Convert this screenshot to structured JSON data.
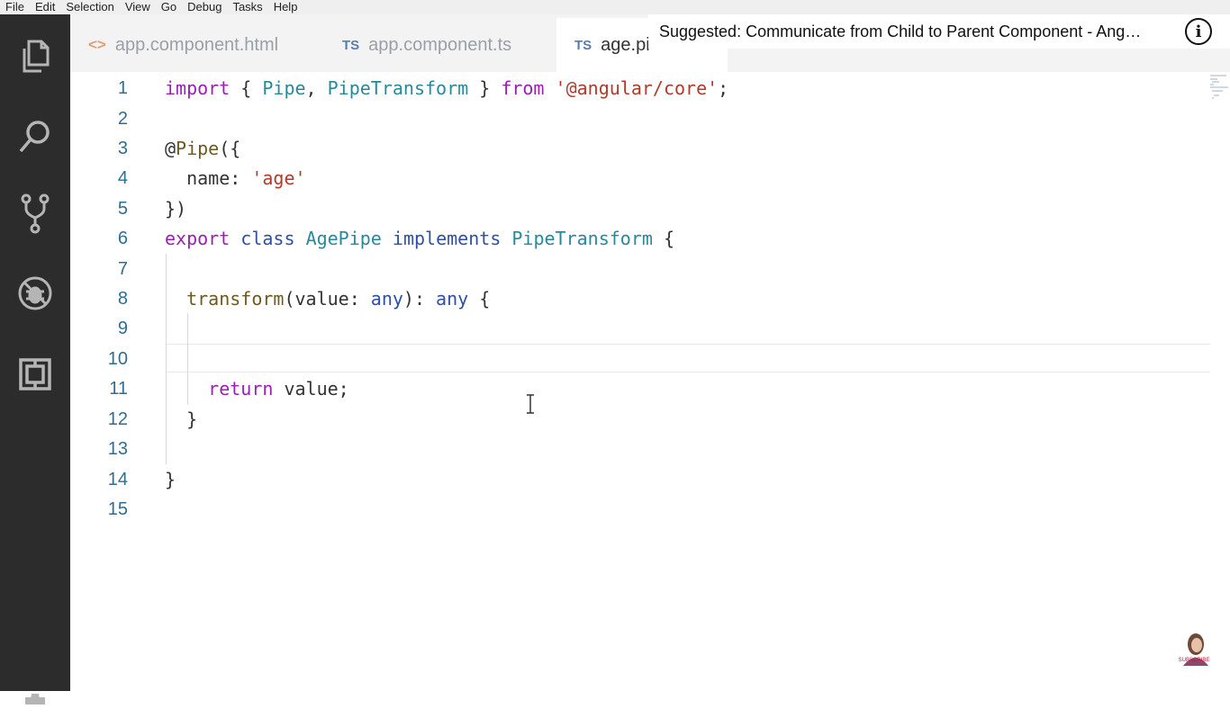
{
  "menu": [
    "File",
    "Edit",
    "Selection",
    "View",
    "Go",
    "Debug",
    "Tasks",
    "Help"
  ],
  "activity_bar": [
    "explorer-icon",
    "search-icon",
    "source-control-icon",
    "debug-icon",
    "extensions-icon",
    "settings-gear-icon"
  ],
  "tabs": [
    {
      "icon": "<>",
      "label": "app.component.html"
    },
    {
      "icon": "TS",
      "label": "app.component.ts"
    },
    {
      "icon": "TS",
      "label": "age.pi",
      "close": "×"
    }
  ],
  "suggestion": {
    "text": "Suggested: Communicate from Child to Parent Component - Ang…",
    "info": "i"
  },
  "editor": {
    "line_numbers": [
      "1",
      "2",
      "3",
      "4",
      "5",
      "6",
      "7",
      "8",
      "9",
      "10",
      "11",
      "12",
      "13",
      "14",
      "15"
    ],
    "l1": {
      "kw_import": "import",
      "p1": " { ",
      "c1": "Pipe",
      "p2": ", ",
      "c2": "PipeTransform",
      "p3": " } ",
      "kw_from": "from",
      "p4": " ",
      "s1": "'@angular/core'",
      "p5": ";"
    },
    "l3": {
      "t1": "@",
      "f1": "Pipe",
      "t2": "({"
    },
    "l4": {
      "t1": "  name: ",
      "s1": "'age'"
    },
    "l5": {
      "t1": "})"
    },
    "l6": {
      "k1": "export",
      "p1": " ",
      "k2": "class",
      "p2": " ",
      "c1": "AgePipe",
      "p3": " ",
      "k3": "implements",
      "p4": " ",
      "c2": "PipeTransform",
      "p5": " {"
    },
    "l8": {
      "t0": "  ",
      "f1": "transform",
      "t1": "(value: ",
      "ty1": "any",
      "t2": "): ",
      "ty2": "any",
      "t3": " {"
    },
    "l11": {
      "t0": "    ",
      "k1": "return",
      "t1": " value;"
    },
    "l12": {
      "t1": "  }"
    },
    "l14": {
      "t1": "}"
    }
  },
  "watermark": "SUBSCRIBE"
}
